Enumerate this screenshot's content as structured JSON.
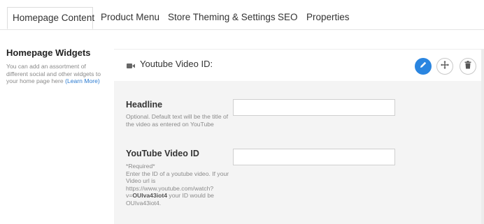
{
  "tabs": [
    {
      "label": "Homepage Content",
      "active": true
    },
    {
      "label": "Product Menu",
      "active": false
    },
    {
      "label": "Store Theming & Settings",
      "active": false
    },
    {
      "label": "SEO",
      "active": false
    },
    {
      "label": "Properties",
      "active": false
    }
  ],
  "sidebar": {
    "title": "Homepage Widgets",
    "description": "You can add an assortment of different social and other widgets to your home page here",
    "learn_more": "(Learn More)"
  },
  "widget": {
    "icon": "video-camera-icon",
    "title": "Youtube Video ID:",
    "actions": [
      {
        "name": "edit",
        "icon": "pencil-icon",
        "color": "#2a85e0"
      },
      {
        "name": "move",
        "icon": "move-arrows-icon"
      },
      {
        "name": "delete",
        "icon": "trash-icon"
      }
    ]
  },
  "fields": {
    "headline": {
      "label": "Headline",
      "help": "Optional. Default text will be the title of the video as entered on YouTube",
      "value": "",
      "placeholder": ""
    },
    "video_id": {
      "label": "YouTube Video ID",
      "required": "*Required*",
      "help_intro": "Enter the ID of a youtube video. If your Video url is https://www.youtube.com/watch?v=",
      "example_id": "OUIva43iot4",
      "help_mid": " your ID would be OUIva43iot4.",
      "value": "",
      "placeholder": ""
    }
  },
  "colors": {
    "accent": "#2a85e0",
    "link": "#2a7ad0",
    "form_background": "#f4f4f4"
  }
}
